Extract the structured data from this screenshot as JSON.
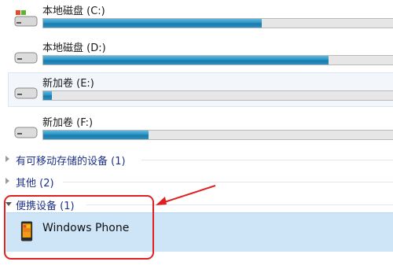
{
  "drives": [
    {
      "name": "本地磁盘 (C:)",
      "used_fraction": 0.62,
      "icon": "windows-drive-icon"
    },
    {
      "name": "本地磁盘 (D:)",
      "used_fraction": 0.81,
      "icon": "hard-drive-icon"
    },
    {
      "name": "新加卷 (E:)",
      "used_fraction": 0.025,
      "icon": "hard-drive-icon"
    },
    {
      "name": "新加卷 (F:)",
      "used_fraction": 0.3,
      "icon": "hard-drive-icon"
    }
  ],
  "groups": {
    "removable": "有可移动存储的设备 (1)",
    "other": "其他 (2)",
    "portable": "便携设备 (1)"
  },
  "device": {
    "name": "Windows Phone",
    "icon": "windows-phone-icon"
  },
  "colors": {
    "bar_fill": "#2a94c4",
    "selection": "#cde5f7",
    "annotation": "#e02020"
  }
}
